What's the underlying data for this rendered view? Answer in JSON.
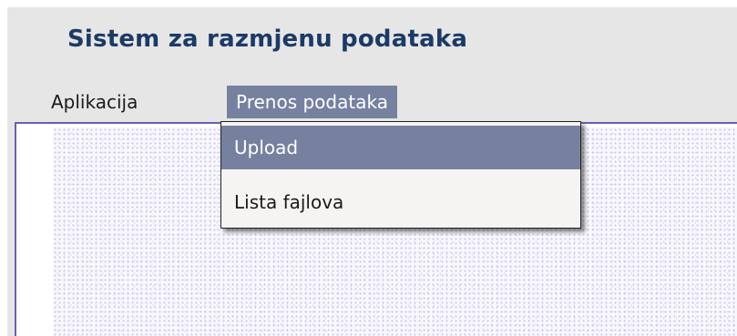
{
  "app": {
    "title": "Sistem za razmjenu podataka"
  },
  "menubar": {
    "items": [
      {
        "label": "Aplikacija",
        "active": false
      },
      {
        "label": "Prenos podataka",
        "active": true
      }
    ]
  },
  "dropdown": {
    "items": [
      {
        "label": "Upload",
        "highlighted": true
      },
      {
        "label": "Lista fajlova",
        "highlighted": false
      }
    ]
  },
  "colors": {
    "title": "#1c3a66",
    "highlight": "#76819f",
    "frame_border": "#6c5fab",
    "background": "#e6e6e6"
  }
}
